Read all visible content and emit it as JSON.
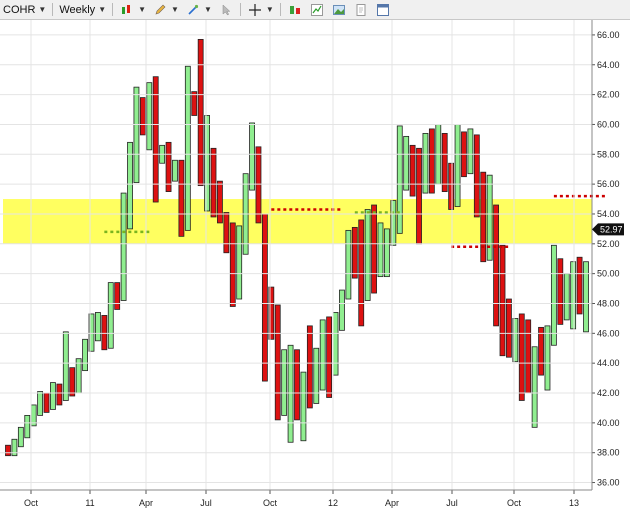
{
  "toolbar": {
    "symbol": "COHR",
    "period": "Weekly",
    "icons": [
      "draw-pencil-icon",
      "cursor-icon",
      "crosshair-icon",
      "candles-icon",
      "line-chart-icon",
      "picture-icon",
      "document-icon",
      "window-icon"
    ]
  },
  "chart_data": {
    "type": "bar",
    "symbol": "COHR",
    "timeframe": "Weekly",
    "last_price": 52.97,
    "last_price_label": "52.97",
    "ylim": [
      35.5,
      67.0
    ],
    "yticks": [
      "36.00",
      "38.00",
      "40.00",
      "42.00",
      "44.00",
      "46.00",
      "48.00",
      "50.00",
      "52.00",
      "54.00",
      "56.00",
      "58.00",
      "60.00",
      "62.00",
      "64.00",
      "66.00"
    ],
    "xticks": [
      "Oct",
      "11",
      "Apr",
      "Jul",
      "Oct",
      "12",
      "Apr",
      "Jul",
      "Oct",
      "13"
    ],
    "colors": {
      "up": "#90ee90",
      "down": "#dd1111",
      "zone": "#ffff44",
      "support": "#7ab41e",
      "resistance": "#cc0000"
    },
    "highlight_zone": [
      52.0,
      55.0
    ],
    "support_levels": [
      {
        "price": 52.8,
        "from_bar": 15,
        "to_bar": 22
      },
      {
        "price": 54.1,
        "from_bar": 54,
        "to_bar": 61
      }
    ],
    "resistance_levels": [
      {
        "price": 54.3,
        "from_bar": 41,
        "to_bar": 52
      },
      {
        "price": 51.8,
        "from_bar": 69,
        "to_bar": 78
      },
      {
        "price": 55.2,
        "from_bar": 85,
        "to_bar": 93
      }
    ],
    "bars": [
      [
        38.2,
        37.9,
        38.5,
        37.8
      ],
      [
        37.9,
        38.6,
        38.9,
        37.8
      ],
      [
        38.6,
        39.3,
        39.7,
        38.4
      ],
      [
        39.2,
        40.1,
        40.5,
        39.0
      ],
      [
        40.0,
        40.9,
        41.2,
        39.8
      ],
      [
        40.8,
        41.7,
        42.1,
        40.5
      ],
      [
        41.6,
        41.0,
        42.0,
        40.7
      ],
      [
        41.1,
        42.3,
        42.7,
        40.9
      ],
      [
        42.2,
        41.6,
        42.6,
        41.2
      ],
      [
        41.7,
        43.4,
        46.1,
        41.5
      ],
      [
        43.3,
        42.3,
        43.7,
        41.8
      ],
      [
        42.4,
        43.9,
        44.3,
        42.0
      ],
      [
        43.8,
        45.1,
        45.6,
        43.5
      ],
      [
        45.0,
        45.8,
        47.3,
        44.8
      ],
      [
        45.8,
        47.0,
        47.4,
        45.5
      ],
      [
        46.8,
        45.2,
        47.2,
        44.9
      ],
      [
        45.2,
        49.2,
        49.4,
        45.0
      ],
      [
        49.1,
        48.1,
        49.4,
        47.6
      ],
      [
        48.2,
        53.5,
        55.4,
        52.0
      ],
      [
        53.4,
        56.5,
        58.8,
        53.0
      ],
      [
        56.4,
        61.6,
        62.5,
        56.1
      ],
      [
        61.5,
        59.9,
        61.8,
        59.3
      ],
      [
        59.9,
        62.6,
        62.8,
        58.3
      ],
      [
        62.5,
        57.9,
        63.2,
        54.8
      ],
      [
        58.0,
        58.3,
        58.6,
        57.4
      ],
      [
        58.3,
        56.9,
        58.8,
        55.5
      ],
      [
        56.8,
        57.0,
        57.6,
        56.2
      ],
      [
        57.0,
        52.9,
        57.6,
        52.5
      ],
      [
        53.0,
        61.5,
        63.9,
        52.9
      ],
      [
        61.4,
        61.2,
        62.2,
        60.6
      ],
      [
        61.2,
        56.6,
        65.7,
        55.9
      ],
      [
        56.7,
        58.1,
        60.6,
        54.2
      ],
      [
        58.1,
        54.1,
        58.4,
        53.8
      ],
      [
        54.1,
        53.8,
        56.2,
        53.4
      ],
      [
        53.9,
        51.9,
        54.1,
        51.4
      ],
      [
        52.0,
        48.2,
        53.4,
        47.8
      ],
      [
        48.3,
        51.3,
        53.2,
        50.5
      ],
      [
        51.4,
        56.0,
        56.7,
        51.3
      ],
      [
        56.1,
        58.3,
        60.1,
        55.6
      ],
      [
        58.3,
        53.5,
        58.5,
        53.4
      ],
      [
        53.6,
        48.8,
        54.0,
        42.8
      ],
      [
        48.8,
        46.9,
        49.1,
        45.6
      ],
      [
        47.1,
        41.1,
        47.9,
        40.2
      ],
      [
        41.0,
        43.6,
        44.9,
        40.5
      ],
      [
        43.6,
        44.2,
        45.2,
        38.7
      ],
      [
        44.3,
        40.8,
        44.9,
        40.2
      ],
      [
        41.0,
        42.1,
        43.4,
        38.8
      ],
      [
        42.0,
        41.3,
        46.5,
        41.0
      ],
      [
        41.3,
        43.4,
        45.0,
        42.9
      ],
      [
        43.5,
        45.1,
        46.9,
        42.2
      ],
      [
        45.1,
        43.6,
        47.1,
        41.7
      ],
      [
        43.5,
        47.0,
        47.4,
        43.2
      ],
      [
        47.0,
        48.6,
        48.9,
        46.2
      ],
      [
        48.6,
        52.6,
        52.9,
        48.3
      ],
      [
        52.7,
        50.5,
        53.1,
        49.7
      ],
      [
        50.6,
        48.4,
        53.6,
        46.5
      ],
      [
        48.4,
        53.7,
        54.3,
        48.2
      ],
      [
        53.7,
        49.8,
        54.6,
        48.7
      ],
      [
        49.8,
        50.6,
        53.4,
        50.3
      ],
      [
        50.5,
        52.4,
        53.0,
        49.8
      ],
      [
        52.6,
        52.7,
        54.9,
        51.9
      ],
      [
        52.7,
        57.4,
        59.9,
        54.6
      ],
      [
        57.5,
        58.3,
        59.2,
        55.6
      ],
      [
        58.3,
        56.4,
        58.6,
        55.2
      ],
      [
        56.5,
        55.8,
        58.4,
        52.0
      ],
      [
        55.7,
        58.5,
        59.4,
        55.4
      ],
      [
        58.4,
        56.0,
        59.7,
        55.4
      ],
      [
        56.0,
        58.8,
        60.0,
        57.3
      ],
      [
        58.9,
        56.1,
        59.4,
        55.5
      ],
      [
        56.2,
        55.0,
        57.4,
        54.3
      ],
      [
        54.9,
        58.0,
        60.0,
        54.5
      ],
      [
        58.0,
        56.9,
        59.5,
        56.5
      ],
      [
        57.1,
        58.7,
        59.7,
        56.7
      ],
      [
        58.6,
        55.1,
        59.3,
        53.8
      ],
      [
        55.1,
        51.8,
        56.8,
        50.8
      ],
      [
        51.7,
        53.4,
        56.6,
        50.9
      ],
      [
        53.4,
        51.4,
        54.6,
        46.5
      ],
      [
        51.4,
        47.9,
        51.9,
        44.5
      ],
      [
        47.9,
        45.3,
        48.3,
        44.4
      ],
      [
        45.3,
        46.5,
        47.0,
        44.1
      ],
      [
        46.6,
        43.9,
        47.3,
        41.5
      ],
      [
        43.9,
        43.2,
        46.9,
        42.0
      ],
      [
        43.3,
        44.9,
        45.1,
        39.7
      ],
      [
        44.8,
        44.2,
        46.4,
        43.2
      ],
      [
        44.2,
        45.2,
        46.5,
        42.2
      ],
      [
        45.2,
        47.9,
        51.9,
        46.2
      ],
      [
        48.0,
        47.5,
        51.0,
        46.6
      ],
      [
        47.5,
        49.4,
        50.0,
        46.9
      ],
      [
        49.4,
        50.3,
        50.8,
        46.3
      ],
      [
        50.2,
        47.8,
        51.1,
        47.3
      ],
      [
        47.9,
        49.7,
        50.8,
        46.1
      ]
    ]
  }
}
